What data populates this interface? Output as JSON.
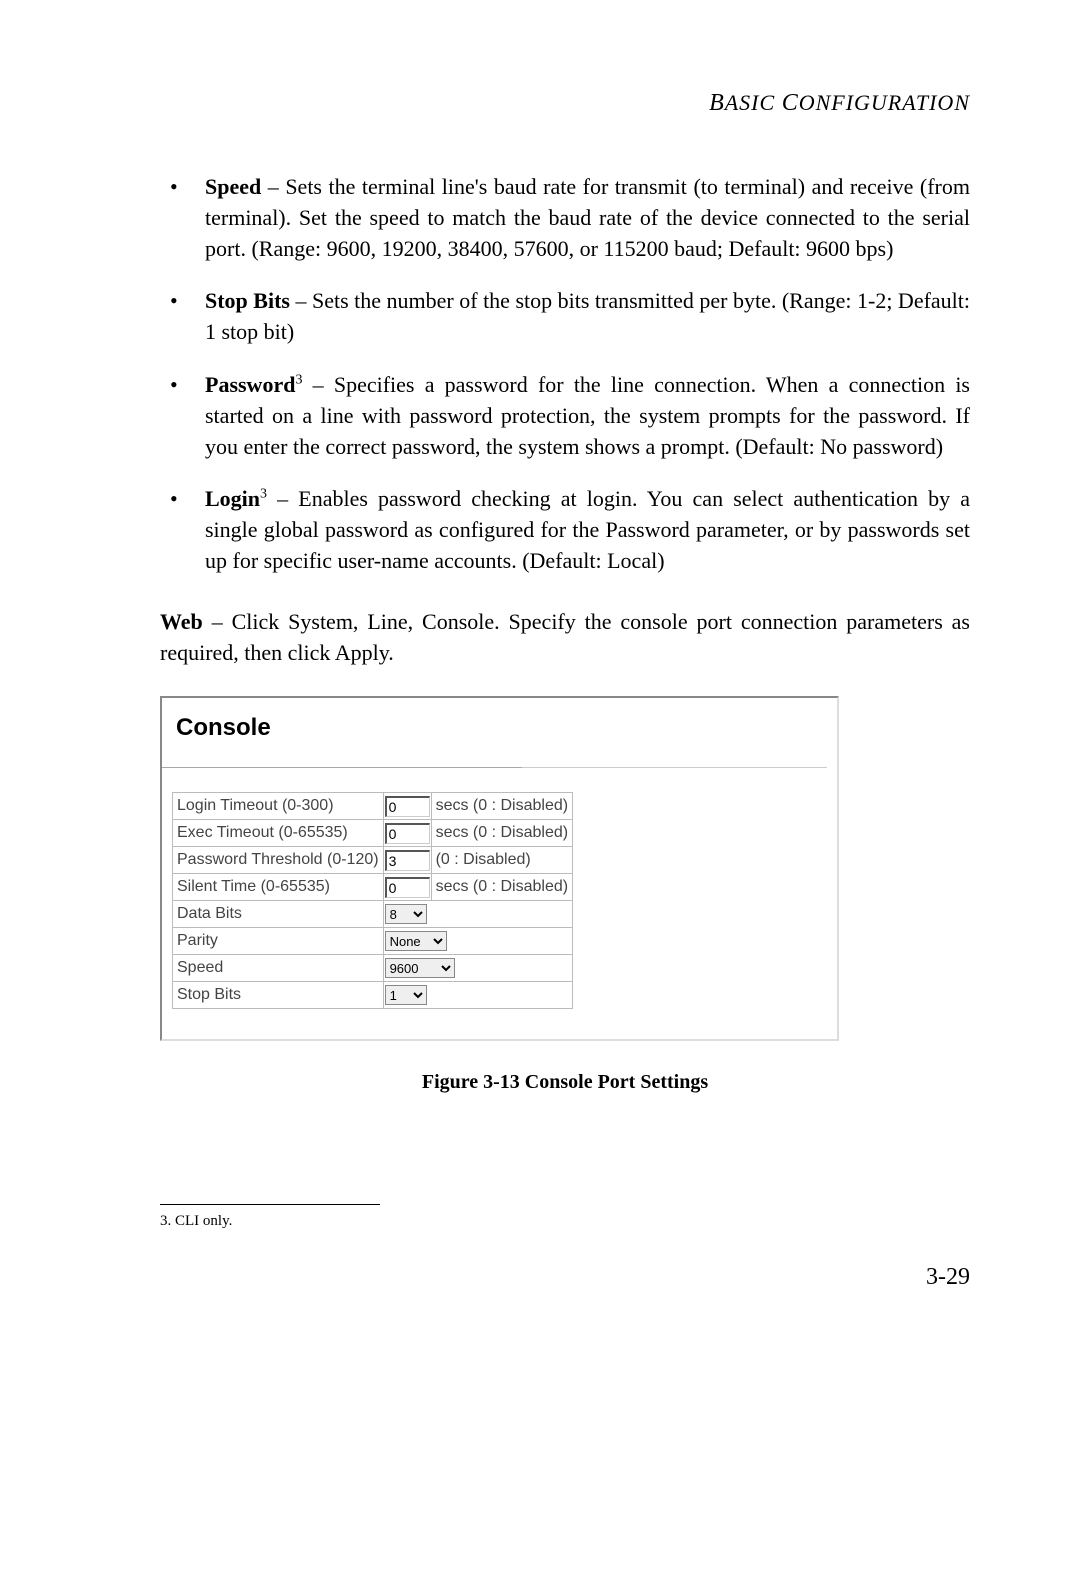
{
  "header": {
    "text_pre": "B",
    "text_word1_rest": "ASIC ",
    "text_mid": "C",
    "text_word2_rest": "ONFIGURATION"
  },
  "bullets": [
    {
      "term": "Speed",
      "sup": "",
      "rest": " – Sets the terminal line's baud rate for transmit (to terminal) and receive (from terminal). Set the speed to match the baud rate of the device connected to the serial port. (Range: 9600, 19200, 38400, 57600, or 115200 baud; Default: 9600 bps)"
    },
    {
      "term": "Stop Bits",
      "sup": "",
      "rest": " – Sets the number of the stop bits transmitted per byte. (Range: 1-2; Default: 1 stop bit)"
    },
    {
      "term": "Password",
      "sup": "3",
      "rest": " – Specifies a password for the line connection. When a connection is started on a line with password protection, the system prompts for the password. If you enter the correct password, the system shows a prompt. (Default: No password)"
    },
    {
      "term": "Login",
      "sup": "3",
      "rest": " – Enables password checking at login. You can select authentication by a single global password as configured for the Password parameter, or by passwords set up for specific user-name accounts. (Default: Local)"
    }
  ],
  "web": {
    "term": "Web",
    "rest": " – Click System, Line, Console. Specify the console port connection parameters as required, then click Apply."
  },
  "console": {
    "title": "Console",
    "rows": [
      {
        "label": "Login Timeout (0-300)",
        "type": "text",
        "value": "0",
        "note": "secs (0 : Disabled)"
      },
      {
        "label": "Exec Timeout (0-65535)",
        "type": "text",
        "value": "0",
        "note": "secs (0 : Disabled)"
      },
      {
        "label": "Password Threshold (0-120)",
        "type": "text",
        "value": "3",
        "note": "(0 : Disabled)"
      },
      {
        "label": "Silent Time (0-65535)",
        "type": "text",
        "value": "0",
        "note": "secs (0 : Disabled)"
      },
      {
        "label": "Data Bits",
        "type": "select",
        "value": "8",
        "note": ""
      },
      {
        "label": "Parity",
        "type": "select",
        "value": "None",
        "note": ""
      },
      {
        "label": "Speed",
        "type": "select",
        "value": "9600",
        "note": ""
      },
      {
        "label": "Stop Bits",
        "type": "select",
        "value": "1",
        "note": ""
      }
    ]
  },
  "figure_caption": "Figure 3-13  Console Port Settings",
  "footnote": "3.  CLI only.",
  "page_num": "3-29"
}
